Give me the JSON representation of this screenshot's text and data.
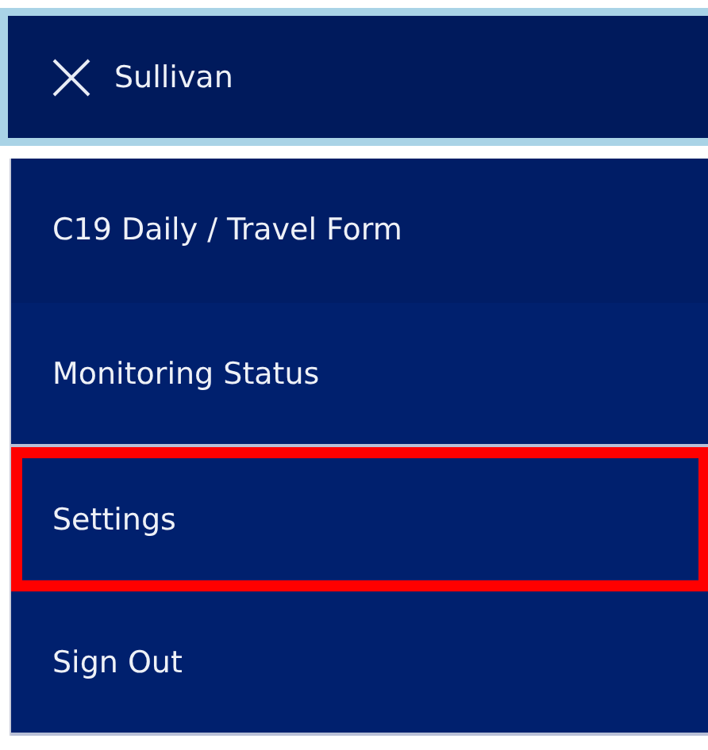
{
  "header": {
    "title": "Sullivan"
  },
  "menu": [
    {
      "label": "C19 Daily / Travel Form",
      "highlighted": false,
      "divider": false
    },
    {
      "label": "Monitoring Status",
      "highlighted": false,
      "divider": true
    },
    {
      "label": "Settings",
      "highlighted": true,
      "divider": false
    },
    {
      "label": "Sign Out",
      "highlighted": false,
      "divider": true
    }
  ]
}
